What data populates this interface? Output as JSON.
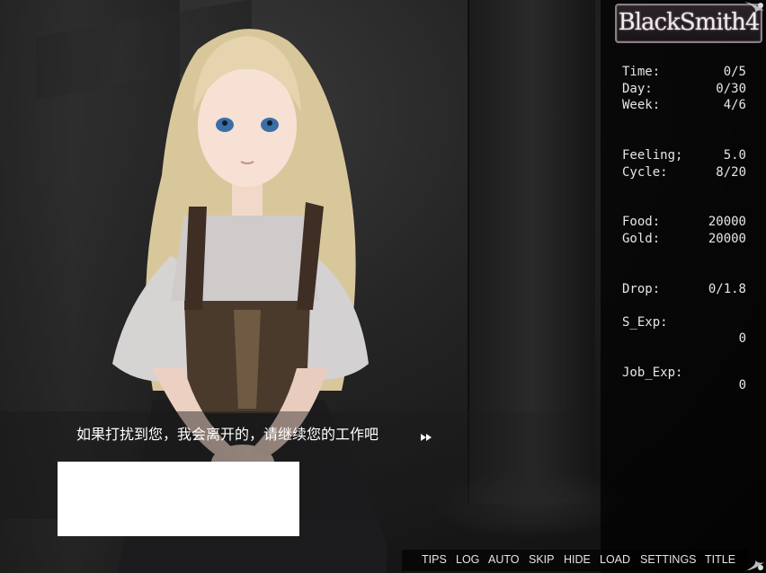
{
  "game": {
    "logo": "BlackSmith4"
  },
  "stats": [
    {
      "label": "Time:",
      "value": "0/5"
    },
    {
      "label": "Day:",
      "value": "0/30"
    },
    {
      "label": "Week:",
      "value": "4/6"
    },
    {
      "label": "Feeling;",
      "value": "5.0"
    },
    {
      "label": "Cycle:",
      "value": "8/20"
    },
    {
      "label": "Food:",
      "value": "20000"
    },
    {
      "label": "Gold:",
      "value": "20000"
    },
    {
      "label": "Drop:",
      "value": "0/1.8"
    },
    {
      "label": "S_Exp:",
      "value": "0"
    },
    {
      "label": "Job_Exp:",
      "value": "0"
    }
  ],
  "dialog": {
    "text": "如果打扰到您，我会离开的，请继续您的工作吧"
  },
  "menu": {
    "tips": "TIPS",
    "log": "LOG",
    "auto": "AUTO",
    "skip": "SKIP",
    "hide": "HIDE",
    "load": "LOAD",
    "settings": "SETTINGS",
    "title": "TITLE"
  },
  "icons": {
    "advance": "fast-forward-icon",
    "corner": "ornament-corner-icon"
  },
  "colors": {
    "panel": "#000000",
    "text": "#e6e6e6",
    "logo_border": "#8a7e86"
  }
}
